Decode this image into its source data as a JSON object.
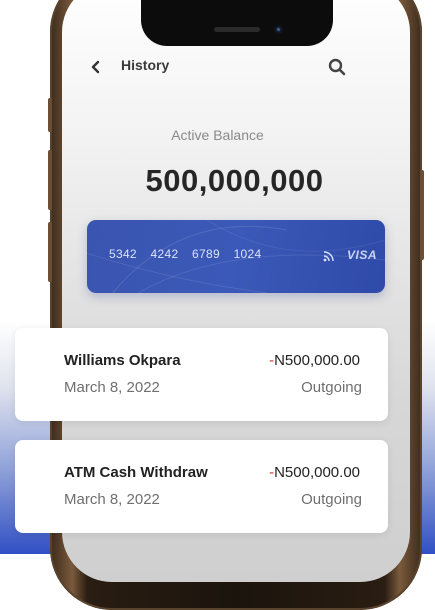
{
  "header": {
    "title": "History"
  },
  "balance": {
    "label": "Active Balance",
    "value": "500,000,000"
  },
  "card": {
    "number": "5342 4242 6789 1024",
    "brand": "VISA",
    "color": "#3b59b8"
  },
  "transactions": [
    {
      "name": "Williams Okpara",
      "date": "March 8, 2022",
      "amount_sign": "-",
      "amount": "N500,000.00",
      "type": "Outgoing"
    },
    {
      "name": "ATM Cash Withdraw",
      "date": "March 8, 2022",
      "amount_sign": "-",
      "amount": "N500,000.00",
      "type": "Outgoing"
    }
  ],
  "icons": {
    "back": "chevron-left-icon",
    "search": "search-icon",
    "contactless": "contactless-icon"
  },
  "colors": {
    "negative": "#d43a3a",
    "card_blue": "#3b59b8",
    "page_gradient_bottom": "#3150c4"
  }
}
